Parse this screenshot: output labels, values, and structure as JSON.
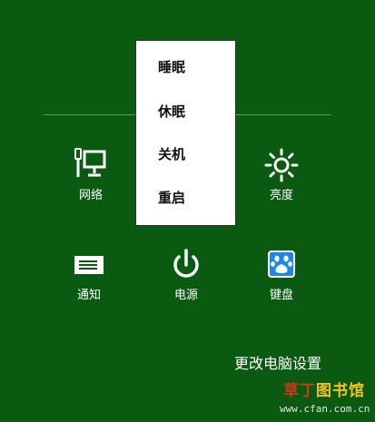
{
  "tiles": {
    "network": {
      "label": "网络",
      "icon": "network-icon"
    },
    "brightness": {
      "label": "亮度",
      "icon": "brightness-icon"
    },
    "notifications": {
      "label": "通知",
      "icon": "notification-icon"
    },
    "power": {
      "label": "电源",
      "icon": "power-icon"
    },
    "keyboard": {
      "label": "键盘",
      "icon": "keyboard-icon"
    }
  },
  "power_menu": {
    "items": [
      {
        "label": "睡眠"
      },
      {
        "label": "休眠"
      },
      {
        "label": "关机"
      },
      {
        "label": "重启"
      }
    ]
  },
  "footer": {
    "pc_settings_label": "更改电脑设置"
  },
  "watermark": {
    "brand_part1": "草丁",
    "brand_part2": "图书馆",
    "domain": "www.cfan.com.cn"
  },
  "colors": {
    "background": "#0a5a12",
    "menu_background": "#ffffff",
    "keyboard_icon_bg": "#1e88e5",
    "watermark_red": "#d1351a",
    "watermark_yellow": "#f4c21f"
  }
}
